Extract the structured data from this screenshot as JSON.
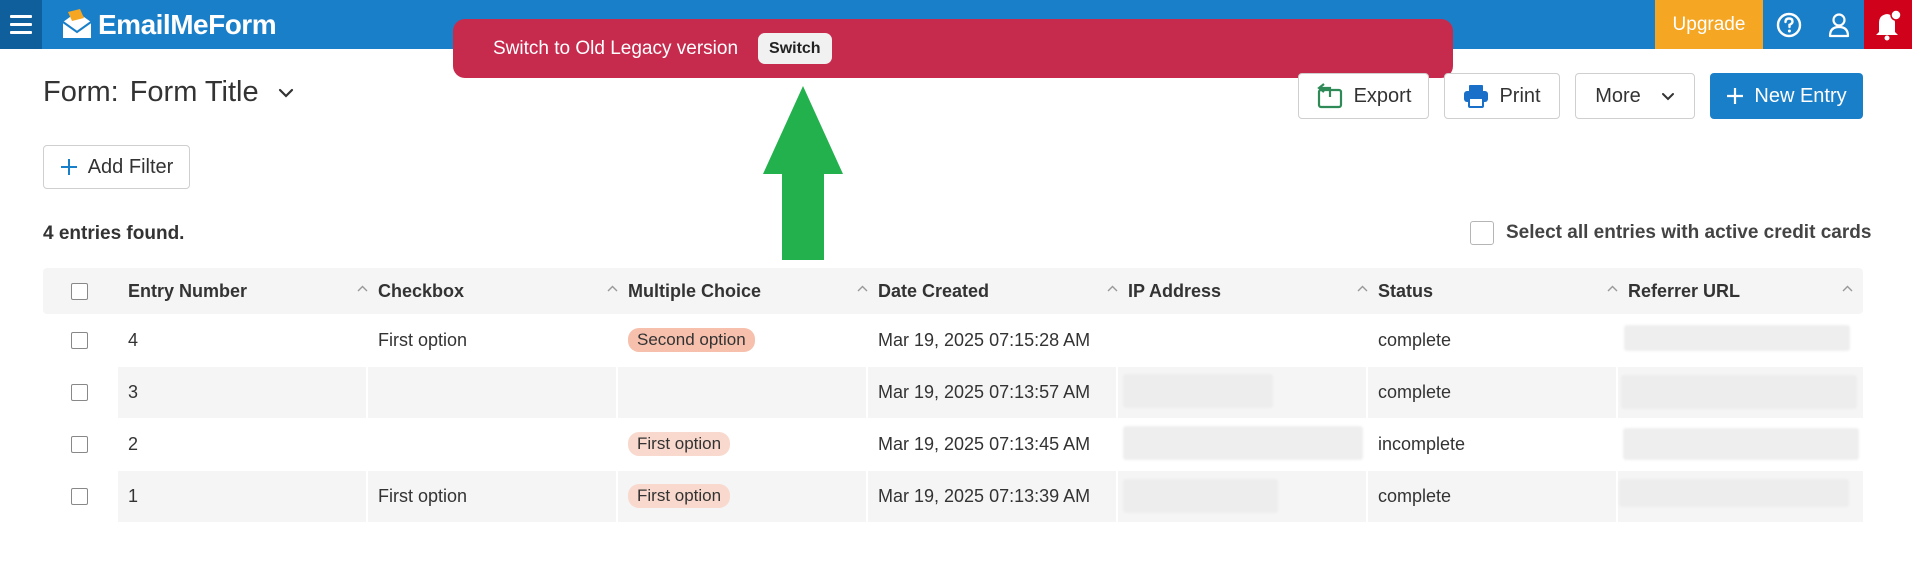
{
  "topbar": {
    "brand": "EmailMeForm",
    "upgrade_label": "Upgrade",
    "icons": [
      "menu-icon",
      "help-icon",
      "user-icon",
      "bell-icon"
    ],
    "colors": {
      "bar": "#1a7fc9",
      "upgrade": "#f5a623",
      "alert": "#d0021b"
    }
  },
  "banner": {
    "text": "Switch to Old Legacy version",
    "button_label": "Switch",
    "color": "#c62b4e"
  },
  "page": {
    "title_prefix": "Form:",
    "title": "Form Title",
    "add_filter_label": "Add Filter",
    "entries_found": "4 entries found.",
    "select_all_label": "Select all entries with active credit cards"
  },
  "toolbar": {
    "export_label": "Export",
    "print_label": "Print",
    "more_label": "More",
    "new_entry_label": "New Entry"
  },
  "table": {
    "columns": [
      "Entry Number",
      "Checkbox",
      "Multiple Choice",
      "Date Created",
      "IP Address",
      "Status",
      "Referrer URL"
    ],
    "rows": [
      {
        "entry": "4",
        "checkbox": "First option",
        "choice": "Second option",
        "date": "Mar 19, 2025 07:15:28 AM",
        "status": "complete"
      },
      {
        "entry": "3",
        "checkbox": "",
        "choice": "",
        "date": "Mar 19, 2025 07:13:57 AM",
        "status": "complete"
      },
      {
        "entry": "2",
        "checkbox": "",
        "choice": "First option",
        "date": "Mar 19, 2025 07:13:45 AM",
        "status": "incomplete"
      },
      {
        "entry": "1",
        "checkbox": "First option",
        "choice": "First option",
        "date": "Mar 19, 2025 07:13:39 AM",
        "status": "complete"
      }
    ]
  }
}
